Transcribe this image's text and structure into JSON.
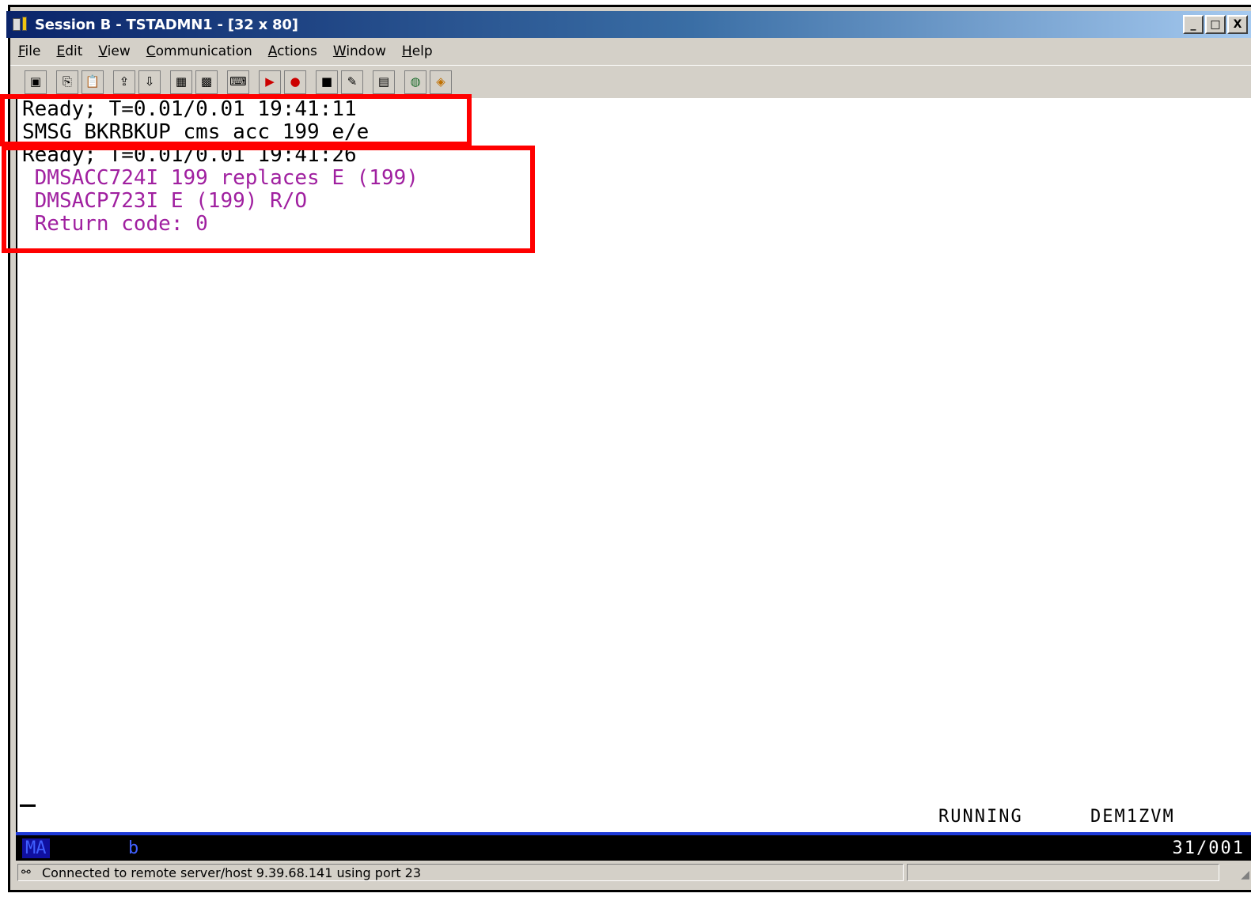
{
  "window": {
    "title": "Session B - TSTADMN1 - [32 x 80]",
    "controls": [
      "_",
      "□",
      "X"
    ]
  },
  "menu": {
    "items": [
      {
        "label": "File",
        "ul": "F",
        "rest": "ile"
      },
      {
        "label": "Edit",
        "ul": "E",
        "rest": "dit"
      },
      {
        "label": "View",
        "ul": "V",
        "rest": "iew"
      },
      {
        "label": "Communication",
        "ul": "C",
        "rest": "ommunication"
      },
      {
        "label": "Actions",
        "ul": "A",
        "rest": "ctions"
      },
      {
        "label": "Window",
        "ul": "W",
        "rest": "indow"
      },
      {
        "label": "Help",
        "ul": "H",
        "rest": "elp"
      }
    ]
  },
  "toolbar": {
    "icons": [
      "print-screen-icon",
      "copy-icon",
      "paste-icon",
      "send-file-icon",
      "receive-file-icon",
      "display-icon",
      "keypad-icon",
      "keyboard-map-icon",
      "macro-play-icon",
      "macro-record-icon",
      "macro-stop-icon",
      "macro-edit-icon",
      "clipboard-icon",
      "globe-icon",
      "help-icon"
    ]
  },
  "terminal": {
    "lines": [
      {
        "text": "Ready; T=0.01/0.01 19:41:11",
        "color": "#000000"
      },
      {
        "text": "SMSG BKRBKUP cms acc 199 e/e",
        "color": "#000000"
      },
      {
        "text": "Ready; T=0.01/0.01 19:41:26",
        "color": "#000000"
      },
      {
        "text": " DMSACC724I 199 replaces E (199)",
        "color": "#a020a0"
      },
      {
        "text": " DMSACP723I E (199) R/O",
        "color": "#a020a0"
      },
      {
        "text": " Return code: 0",
        "color": "#a020a0"
      }
    ],
    "status_running": "RUNNING",
    "status_system": "DEM1ZVM"
  },
  "oia": {
    "indicator": "MA",
    "session": "b",
    "cursor_position": "31/001"
  },
  "statusbar": {
    "message": "Connected to remote server/host 9.39.68.141 using port 23"
  },
  "highlight_color": "#ff0000"
}
